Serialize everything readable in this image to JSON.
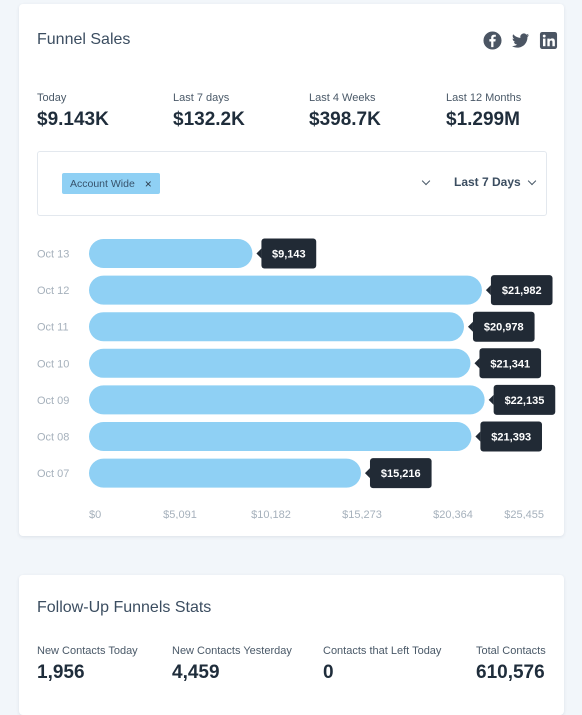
{
  "funnel_sales": {
    "title": "Funnel Sales",
    "social_icons": [
      "facebook-icon",
      "twitter-icon",
      "linkedin-icon"
    ],
    "stats": [
      {
        "label": "Today",
        "value": "$9.143K"
      },
      {
        "label": "Last 7 days",
        "value": "$132.2K"
      },
      {
        "label": "Last 4 Weeks",
        "value": "$398.7K"
      },
      {
        "label": "Last 12 Months",
        "value": "$1.299M"
      }
    ],
    "filter": {
      "tag_label": "Account Wide",
      "tag_close": "×",
      "range_label": "Last 7 Days"
    }
  },
  "chart_data": {
    "type": "bar",
    "orientation": "horizontal",
    "categories": [
      "Oct 13",
      "Oct 12",
      "Oct 11",
      "Oct 10",
      "Oct 09",
      "Oct 08",
      "Oct 07"
    ],
    "values": [
      9143,
      21982,
      20978,
      21341,
      22135,
      21393,
      15216
    ],
    "data_labels": [
      "$9,143",
      "$21,982",
      "$20,978",
      "$21,341",
      "$22,135",
      "$21,393",
      "$15,216"
    ],
    "x_ticks": [
      0,
      5091,
      10182,
      15273,
      20364,
      25455
    ],
    "x_tick_labels": [
      "$0",
      "$5,091",
      "$10,182",
      "$15,273",
      "$20,364",
      "$25,455"
    ],
    "xlim": [
      0,
      25455
    ],
    "bar_color": "#8fd0f4",
    "label_bg_color": "#212a35",
    "grid": false
  },
  "follow_up": {
    "title": "Follow-Up Funnels Stats",
    "stats": [
      {
        "label": "New Contacts Today",
        "value": "1,956"
      },
      {
        "label": "New Contacts Yesterday",
        "value": "4,459"
      },
      {
        "label": "Contacts that Left Today",
        "value": "0"
      },
      {
        "label": "Total Contacts",
        "value": "610,576"
      }
    ]
  }
}
